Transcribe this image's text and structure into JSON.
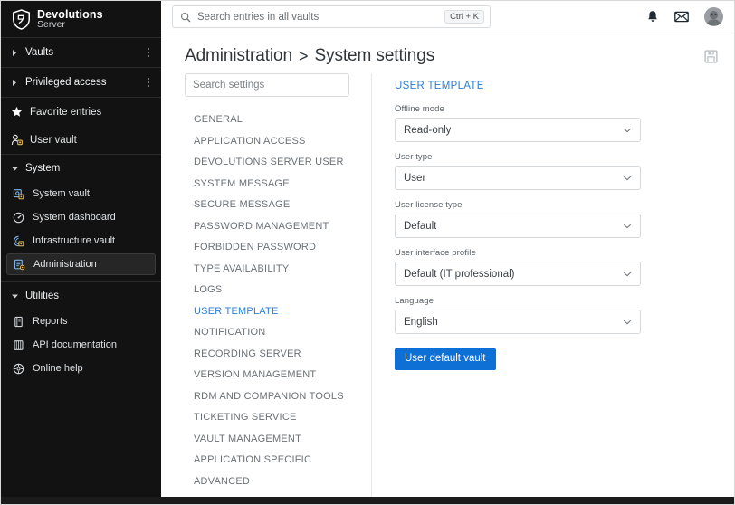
{
  "brand": {
    "name": "Devolutions",
    "sub": "Server",
    "logo_icon": "shield-icon"
  },
  "sidebar": {
    "top_items": [
      {
        "label": "Vaults",
        "caret": "chevron-right-icon",
        "kebab": "kebab-menu-icon"
      },
      {
        "label": "Privileged access",
        "caret": "chevron-right-icon",
        "kebab": "kebab-menu-icon"
      }
    ],
    "quick_items": [
      {
        "label": "Favorite entries",
        "icon": "star-icon"
      },
      {
        "label": "User vault",
        "icon": "user-vault-icon"
      }
    ],
    "groups": [
      {
        "label": "System",
        "caret": "chevron-down-icon",
        "items": [
          {
            "label": "System vault",
            "icon": "system-vault-icon",
            "selected": false
          },
          {
            "label": "System dashboard",
            "icon": "dashboard-icon",
            "selected": false
          },
          {
            "label": "Infrastructure vault",
            "icon": "infrastructure-vault-icon",
            "selected": false
          },
          {
            "label": "Administration",
            "icon": "administration-icon",
            "selected": true
          }
        ]
      },
      {
        "label": "Utilities",
        "caret": "chevron-down-icon",
        "items": [
          {
            "label": "Reports",
            "icon": "reports-icon",
            "selected": false
          },
          {
            "label": "API documentation",
            "icon": "api-docs-icon",
            "selected": false
          },
          {
            "label": "Online help",
            "icon": "help-icon",
            "selected": false
          }
        ]
      }
    ]
  },
  "topbar": {
    "search": {
      "placeholder": "Search entries in all vaults",
      "value": "",
      "icon": "search-icon",
      "shortcut": "Ctrl + K"
    },
    "notifications_icon": "bell-icon",
    "messages_icon": "envelope-icon",
    "avatar_icon": "user-avatar"
  },
  "page": {
    "breadcrumb_root": "Administration",
    "breadcrumb_separator": ">",
    "breadcrumb_current": "System settings",
    "save_icon": "save-floppy-icon"
  },
  "settings": {
    "search_placeholder": "Search settings",
    "search_value": "",
    "items": [
      {
        "label": "GENERAL",
        "active": false
      },
      {
        "label": "APPLICATION ACCESS",
        "active": false
      },
      {
        "label": "DEVOLUTIONS SERVER USER",
        "active": false
      },
      {
        "label": "SYSTEM MESSAGE",
        "active": false
      },
      {
        "label": "SECURE MESSAGE",
        "active": false
      },
      {
        "label": "PASSWORD MANAGEMENT",
        "active": false
      },
      {
        "label": "FORBIDDEN PASSWORD",
        "active": false
      },
      {
        "label": "TYPE AVAILABILITY",
        "active": false
      },
      {
        "label": "LOGS",
        "active": false
      },
      {
        "label": "USER TEMPLATE",
        "active": true
      },
      {
        "label": "NOTIFICATION",
        "active": false
      },
      {
        "label": "RECORDING SERVER",
        "active": false
      },
      {
        "label": "VERSION MANAGEMENT",
        "active": false
      },
      {
        "label": "RDM AND COMPANION TOOLS",
        "active": false
      },
      {
        "label": "TICKETING SERVICE",
        "active": false
      },
      {
        "label": "VAULT MANAGEMENT",
        "active": false
      },
      {
        "label": "APPLICATION SPECIFIC",
        "active": false
      },
      {
        "label": "ADVANCED",
        "active": false
      }
    ]
  },
  "form": {
    "heading": "USER TEMPLATE",
    "fields": [
      {
        "label": "Offline mode",
        "value": "Read-only"
      },
      {
        "label": "User type",
        "value": "User"
      },
      {
        "label": "User license type",
        "value": "Default"
      },
      {
        "label": "User interface profile",
        "value": "Default (IT professional)"
      },
      {
        "label": "Language",
        "value": "English"
      }
    ],
    "button_label": "User default vault"
  },
  "colors": {
    "accent_blue": "#2a7fd4",
    "button_blue": "#0e6fd4",
    "sidebar_bg": "#121212"
  }
}
